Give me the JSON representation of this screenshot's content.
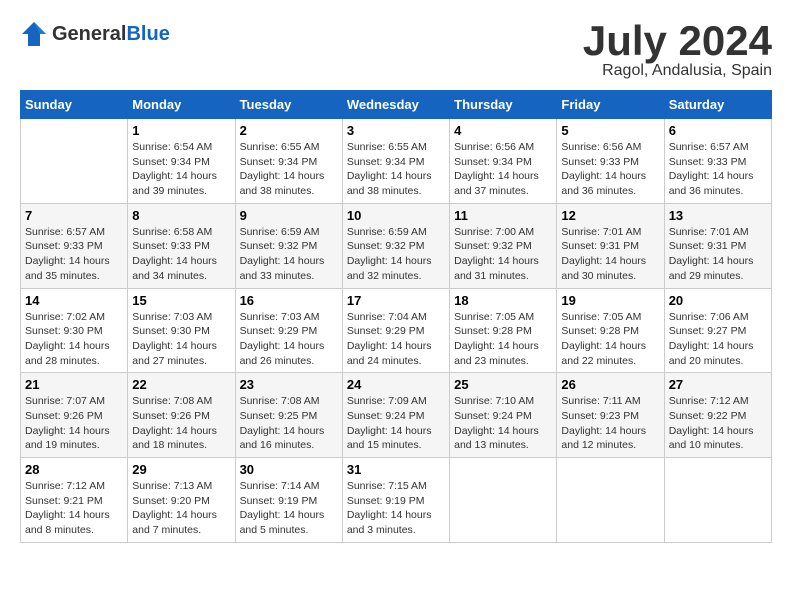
{
  "header": {
    "logo_general": "General",
    "logo_blue": "Blue",
    "title": "July 2024",
    "subtitle": "Ragol, Andalusia, Spain"
  },
  "calendar": {
    "days_of_week": [
      "Sunday",
      "Monday",
      "Tuesday",
      "Wednesday",
      "Thursday",
      "Friday",
      "Saturday"
    ],
    "weeks": [
      [
        {
          "date": "",
          "info": ""
        },
        {
          "date": "1",
          "info": "Sunrise: 6:54 AM\nSunset: 9:34 PM\nDaylight: 14 hours\nand 39 minutes."
        },
        {
          "date": "2",
          "info": "Sunrise: 6:55 AM\nSunset: 9:34 PM\nDaylight: 14 hours\nand 38 minutes."
        },
        {
          "date": "3",
          "info": "Sunrise: 6:55 AM\nSunset: 9:34 PM\nDaylight: 14 hours\nand 38 minutes."
        },
        {
          "date": "4",
          "info": "Sunrise: 6:56 AM\nSunset: 9:34 PM\nDaylight: 14 hours\nand 37 minutes."
        },
        {
          "date": "5",
          "info": "Sunrise: 6:56 AM\nSunset: 9:33 PM\nDaylight: 14 hours\nand 36 minutes."
        },
        {
          "date": "6",
          "info": "Sunrise: 6:57 AM\nSunset: 9:33 PM\nDaylight: 14 hours\nand 36 minutes."
        }
      ],
      [
        {
          "date": "7",
          "info": "Sunrise: 6:57 AM\nSunset: 9:33 PM\nDaylight: 14 hours\nand 35 minutes."
        },
        {
          "date": "8",
          "info": "Sunrise: 6:58 AM\nSunset: 9:33 PM\nDaylight: 14 hours\nand 34 minutes."
        },
        {
          "date": "9",
          "info": "Sunrise: 6:59 AM\nSunset: 9:32 PM\nDaylight: 14 hours\nand 33 minutes."
        },
        {
          "date": "10",
          "info": "Sunrise: 6:59 AM\nSunset: 9:32 PM\nDaylight: 14 hours\nand 32 minutes."
        },
        {
          "date": "11",
          "info": "Sunrise: 7:00 AM\nSunset: 9:32 PM\nDaylight: 14 hours\nand 31 minutes."
        },
        {
          "date": "12",
          "info": "Sunrise: 7:01 AM\nSunset: 9:31 PM\nDaylight: 14 hours\nand 30 minutes."
        },
        {
          "date": "13",
          "info": "Sunrise: 7:01 AM\nSunset: 9:31 PM\nDaylight: 14 hours\nand 29 minutes."
        }
      ],
      [
        {
          "date": "14",
          "info": "Sunrise: 7:02 AM\nSunset: 9:30 PM\nDaylight: 14 hours\nand 28 minutes."
        },
        {
          "date": "15",
          "info": "Sunrise: 7:03 AM\nSunset: 9:30 PM\nDaylight: 14 hours\nand 27 minutes."
        },
        {
          "date": "16",
          "info": "Sunrise: 7:03 AM\nSunset: 9:29 PM\nDaylight: 14 hours\nand 26 minutes."
        },
        {
          "date": "17",
          "info": "Sunrise: 7:04 AM\nSunset: 9:29 PM\nDaylight: 14 hours\nand 24 minutes."
        },
        {
          "date": "18",
          "info": "Sunrise: 7:05 AM\nSunset: 9:28 PM\nDaylight: 14 hours\nand 23 minutes."
        },
        {
          "date": "19",
          "info": "Sunrise: 7:05 AM\nSunset: 9:28 PM\nDaylight: 14 hours\nand 22 minutes."
        },
        {
          "date": "20",
          "info": "Sunrise: 7:06 AM\nSunset: 9:27 PM\nDaylight: 14 hours\nand 20 minutes."
        }
      ],
      [
        {
          "date": "21",
          "info": "Sunrise: 7:07 AM\nSunset: 9:26 PM\nDaylight: 14 hours\nand 19 minutes."
        },
        {
          "date": "22",
          "info": "Sunrise: 7:08 AM\nSunset: 9:26 PM\nDaylight: 14 hours\nand 18 minutes."
        },
        {
          "date": "23",
          "info": "Sunrise: 7:08 AM\nSunset: 9:25 PM\nDaylight: 14 hours\nand 16 minutes."
        },
        {
          "date": "24",
          "info": "Sunrise: 7:09 AM\nSunset: 9:24 PM\nDaylight: 14 hours\nand 15 minutes."
        },
        {
          "date": "25",
          "info": "Sunrise: 7:10 AM\nSunset: 9:24 PM\nDaylight: 14 hours\nand 13 minutes."
        },
        {
          "date": "26",
          "info": "Sunrise: 7:11 AM\nSunset: 9:23 PM\nDaylight: 14 hours\nand 12 minutes."
        },
        {
          "date": "27",
          "info": "Sunrise: 7:12 AM\nSunset: 9:22 PM\nDaylight: 14 hours\nand 10 minutes."
        }
      ],
      [
        {
          "date": "28",
          "info": "Sunrise: 7:12 AM\nSunset: 9:21 PM\nDaylight: 14 hours\nand 8 minutes."
        },
        {
          "date": "29",
          "info": "Sunrise: 7:13 AM\nSunset: 9:20 PM\nDaylight: 14 hours\nand 7 minutes."
        },
        {
          "date": "30",
          "info": "Sunrise: 7:14 AM\nSunset: 9:19 PM\nDaylight: 14 hours\nand 5 minutes."
        },
        {
          "date": "31",
          "info": "Sunrise: 7:15 AM\nSunset: 9:19 PM\nDaylight: 14 hours\nand 3 minutes."
        },
        {
          "date": "",
          "info": ""
        },
        {
          "date": "",
          "info": ""
        },
        {
          "date": "",
          "info": ""
        }
      ]
    ]
  }
}
